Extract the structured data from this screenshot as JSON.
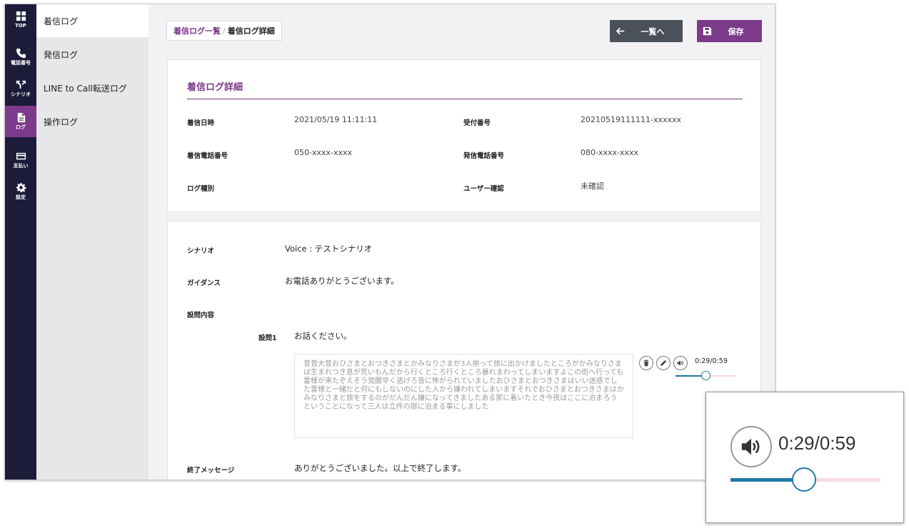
{
  "rail": {
    "items": [
      {
        "label": "TOP",
        "icon": "grid-icon"
      },
      {
        "label": "電話番号",
        "icon": "phone-icon"
      },
      {
        "label": "シナリオ",
        "icon": "branch-icon"
      },
      {
        "label": "ログ",
        "icon": "document-icon",
        "active": true
      },
      {
        "label": "支払い",
        "icon": "card-icon"
      },
      {
        "label": "設定",
        "icon": "gear-icon"
      }
    ]
  },
  "submenu": {
    "items": [
      {
        "label": "着信ログ",
        "active": true
      },
      {
        "label": "発信ログ"
      },
      {
        "label": "LINE to Call転送ログ"
      },
      {
        "label": "操作ログ"
      }
    ]
  },
  "breadcrumb": {
    "parent": "着信ログ一覧",
    "separator": "/",
    "current": "着信ログ詳細"
  },
  "toolbar": {
    "back_label": "一覧へ",
    "save_label": "保存"
  },
  "detail": {
    "title": "着信ログ詳細",
    "fields": {
      "call_datetime_label": "着信日時",
      "call_datetime": "2021/05/19 11:11:11",
      "receipt_no_label": "受付番号",
      "receipt_no": "20210519111111-xxxxxx",
      "incoming_number_label": "着信電話番号",
      "incoming_number": "050-xxxx-xxxx",
      "caller_number_label": "発信電話番号",
      "caller_number": "080-xxxx-xxxx",
      "log_type_label": "ログ種別",
      "log_type": "",
      "user_confirm_label": "ユーザー確認",
      "user_confirm": "未確認"
    }
  },
  "scenario": {
    "scenario_label": "シナリオ",
    "scenario_value": "Voice : テストシナリオ",
    "guidance_label": "ガイダンス",
    "guidance_value": "お電話ありがとうございます。",
    "questions_label": "設問内容",
    "q1_label": "設問1",
    "q1_value": "お話ください。",
    "answer_text": "昔昔大昔おひさまとおつきさまとかみなりさまが3人揃って旅に出かけましたところがかみなりさまは生まれつき息が荒いもんだから行くところ行くところ暴れまわってしまいますよこの街へ行っても雷様が来たぞえそう覚醒早く逃げろ皆に怖がられていましたおひさまとおつきさまはいい迷惑でした雷様と一緒だと何にもしないのにした人から嫌われてしまいますそれでおひさまとおつきさまはかみなりさまと旅をするのがだんだん嫌になってきましたある家に着いたとき今夜はここに泊まろうということになって三人は立件の宿に泊まる事にしました",
    "end_message_label": "終了メッセージ",
    "end_message_value": "ありがとうございました。以上で終了します。"
  },
  "player": {
    "time": "0:29/0:59",
    "progress": 0.49
  },
  "zoom": {
    "time": "0:29/0:59",
    "progress": 0.49
  },
  "colors": {
    "accent": "#7b3a8a",
    "rail_bg": "#1c1b3a",
    "seek": "#1f7aa8"
  }
}
